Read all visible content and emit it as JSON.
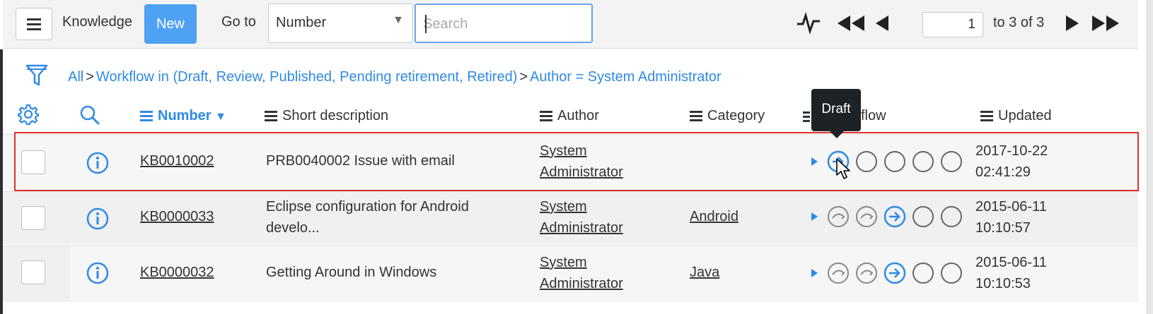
{
  "header": {
    "title": "Knowledge",
    "new_label": "New",
    "goto_label": "Go to",
    "goto_select": "Number",
    "search_placeholder": "Search",
    "page_number": "1",
    "page_count": "to 3 of 3"
  },
  "breadcrumb": {
    "all": "All",
    "sep": ">",
    "crumbs": [
      "Workflow in (Draft, Review, Published, Pending retirement, Retired)",
      "Author = System Administrator"
    ]
  },
  "columns": {
    "number": "Number",
    "short_description": "Short description",
    "author": "Author",
    "category": "Category",
    "workflow": "flow",
    "updated": "Updated"
  },
  "tooltip": "Draft",
  "rows": [
    {
      "number": "KB0010002",
      "desc1": "PRB0040002 Issue with email",
      "desc2": "",
      "author1": "System",
      "author2": "Administrator",
      "category": "",
      "updated1": "2017-10-22",
      "updated2": "02:41:29",
      "stage": 1
    },
    {
      "number": "KB0000033",
      "desc1": "Eclipse configuration for Android",
      "desc2": "develo...",
      "author1": "System",
      "author2": "Administrator",
      "category": "Android",
      "updated1": "2015-06-11",
      "updated2": "10:10:57",
      "stage": 3
    },
    {
      "number": "KB0000032",
      "desc1": "Getting Around in Windows",
      "desc2": "",
      "author1": "System",
      "author2": "Administrator",
      "category": "Java",
      "updated1": "2015-06-11",
      "updated2": "10:10:53",
      "stage": 3
    }
  ],
  "colors": {
    "accent": "#2e8ae6",
    "new_button": "#4ea1f3",
    "highlight_outline": "#e03030",
    "tooltip_bg": "#1c2226"
  }
}
